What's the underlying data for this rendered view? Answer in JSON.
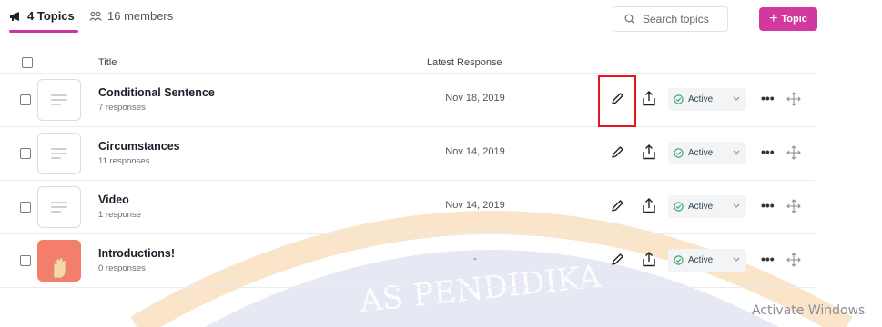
{
  "tabs": {
    "topics_label": "4 Topics",
    "members_label": "16 members"
  },
  "search": {
    "placeholder": "Search topics"
  },
  "add_button": {
    "label": "Topic"
  },
  "table": {
    "col_title": "Title",
    "col_latest": "Latest Response",
    "rows": [
      {
        "title": "Conditional Sentence",
        "responses": "7 responses",
        "latest": "Nov 18, 2019",
        "status": "Active",
        "thumb": "lines"
      },
      {
        "title": "Circumstances",
        "responses": "11 responses",
        "latest": "Nov 14, 2019",
        "status": "Active",
        "thumb": "lines"
      },
      {
        "title": "Video",
        "responses": "1 response",
        "latest": "Nov 14, 2019",
        "status": "Active",
        "thumb": "lines"
      },
      {
        "title": "Introductions!",
        "responses": "0 responses",
        "latest": "-",
        "status": "Active",
        "thumb": "photo"
      }
    ]
  },
  "watermark": {
    "arc_text": "AS PENDIDIKA",
    "windows_text": "Activate Windows"
  },
  "colors": {
    "accent": "#d2399f",
    "status_green": "#3aa76d",
    "highlight": "#e2161e"
  }
}
